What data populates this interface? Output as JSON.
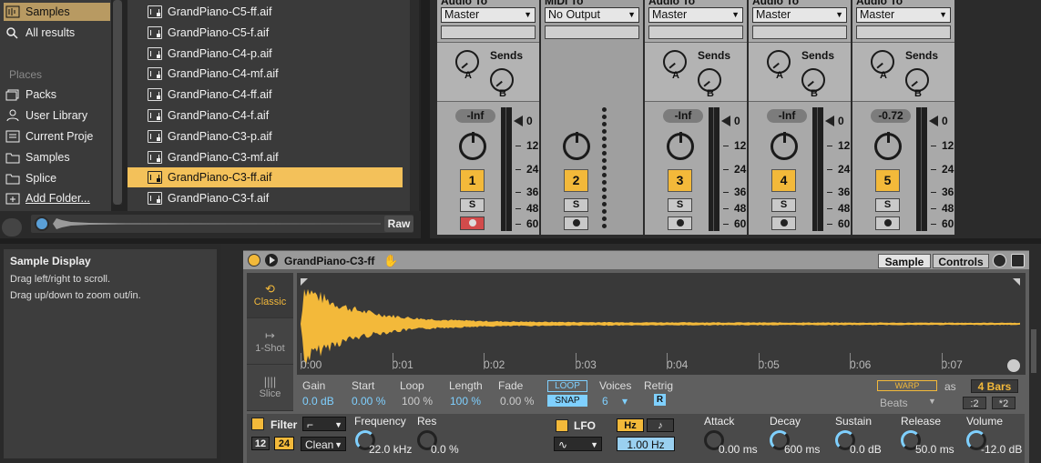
{
  "places": {
    "samples_selected": "Samples",
    "all_results": "All results",
    "header": "Places",
    "items": [
      "Packs",
      "User Library",
      "Current Proje",
      "Samples",
      "Splice",
      "Add Folder..."
    ]
  },
  "files": [
    "GrandPiano-C5-ff.aif",
    "GrandPiano-C5-f.aif",
    "GrandPiano-C4-p.aif",
    "GrandPiano-C4-mf.aif",
    "GrandPiano-C4-ff.aif",
    "GrandPiano-C4-f.aif",
    "GrandPiano-C3-p.aif",
    "GrandPiano-C3-mf.aif",
    "GrandPiano-C3-ff.aif",
    "GrandPiano-C3-f.aif"
  ],
  "selected_file_index": 8,
  "preview": {
    "raw_label": "Raw"
  },
  "mixer": {
    "strips": [
      {
        "header": "Audio To",
        "route": "Master",
        "volume": "-Inf",
        "number": "1",
        "solo": "S",
        "sends_label": "Sends",
        "send_a": "A",
        "send_b": "B",
        "arm": "red"
      },
      {
        "header": "MIDI To",
        "route": "No Output",
        "volume": "",
        "number": "2",
        "solo": "S",
        "sends_label": "",
        "send_a": "",
        "send_b": "",
        "arm": "normal"
      },
      {
        "header": "Audio To",
        "route": "Master",
        "volume": "-Inf",
        "number": "3",
        "solo": "S",
        "sends_label": "Sends",
        "send_a": "A",
        "send_b": "B",
        "arm": "normal"
      },
      {
        "header": "Audio To",
        "route": "Master",
        "volume": "-Inf",
        "number": "4",
        "solo": "S",
        "sends_label": "Sends",
        "send_a": "A",
        "send_b": "B",
        "arm": "normal"
      },
      {
        "header": "Audio To",
        "route": "Master",
        "volume": "-0.72",
        "number": "5",
        "solo": "S",
        "sends_label": "Sends",
        "send_a": "A",
        "send_b": "B",
        "arm": "normal"
      }
    ],
    "scale": [
      "0",
      "12",
      "24",
      "36",
      "48",
      "60"
    ]
  },
  "info": {
    "title": "Sample Display",
    "line1": "Drag left/right to scroll.",
    "line2": "Drag up/down to zoom out/in."
  },
  "device": {
    "title": "GrandPiano-C3-ff",
    "tab_sample": "Sample",
    "tab_controls": "Controls",
    "modes": [
      {
        "glyph": "⟲",
        "label": "Classic"
      },
      {
        "glyph": "↦",
        "label": "1-Shot"
      },
      {
        "glyph": "||||",
        "label": "Slice"
      }
    ],
    "timeline": [
      "0:00",
      "0:01",
      "0:02",
      "0:03",
      "0:04",
      "0:05",
      "0:06",
      "0:07"
    ],
    "params": {
      "gain_label": "Gain",
      "gain": "0.0 dB",
      "start_label": "Start",
      "start": "0.00 %",
      "loop_label": "Loop",
      "loop": "100 %",
      "length_label": "Length",
      "length": "100 %",
      "fade_label": "Fade",
      "fade": "0.00 %",
      "loop_btn": "LOOP",
      "snap_btn": "SNAP",
      "voices_label": "Voices",
      "voices": "6",
      "retrig_label": "Retrig",
      "retrig": "R",
      "warp_btn": "WARP",
      "as_label": "as",
      "bars": "4 Bars",
      "beats": "Beats",
      "half": ":2",
      "double": "*2"
    },
    "filter": {
      "label": "Filter",
      "slope12": "12",
      "slope24": "24",
      "circuit": "Clean",
      "freq_label": "Frequency",
      "freq": "22.0 kHz",
      "res_label": "Res",
      "res": "0.0 %"
    },
    "lfo": {
      "label": "LFO",
      "hz": "Hz",
      "note": "♪",
      "rate": "1.00 Hz"
    },
    "env": {
      "attack_label": "Attack",
      "attack": "0.00 ms",
      "decay_label": "Decay",
      "decay": "600 ms",
      "sustain_label": "Sustain",
      "sustain": "0.0 dB",
      "release_label": "Release",
      "release": "50.0 ms",
      "volume_label": "Volume",
      "volume": "-12.0 dB"
    }
  },
  "colors": {
    "accent": "#f3b93a",
    "blue": "#7fd0ff",
    "selection": "#f3c15a"
  }
}
